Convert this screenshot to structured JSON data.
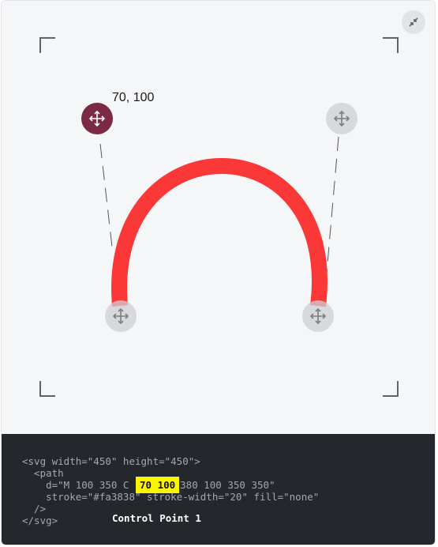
{
  "canvas": {
    "active_point_label": "70, 100",
    "stroke_color": "#fa3838",
    "active_handle_color": "#7b2a44"
  },
  "icons": {
    "fullscreen": "collapse-arrows-icon",
    "handle": "move-arrows-icon"
  },
  "code": {
    "line1": "<svg width=\"450\" height=\"450\">",
    "line2": "  <path",
    "line3_prefix": "    d=\"M 100 350 C",
    "line3_highlight": "70 100",
    "line3_suffix": "380 100 350 350\"",
    "line4": "    stroke=\"#fa3838\" stroke-width=\"20\" fill=\"none\"",
    "line5": "  />",
    "line6": "</svg>",
    "caption": "Control Point 1"
  }
}
